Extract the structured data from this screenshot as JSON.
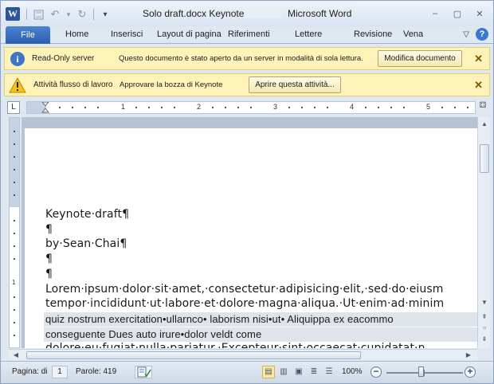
{
  "title": {
    "app_letter": "W",
    "document": "Solo draft.docx Keynote -",
    "app": "Microsoft Word"
  },
  "window_controls": {
    "minimize": "–",
    "restore": "▢",
    "close": "✕"
  },
  "ribbon": {
    "file": "File",
    "tabs": [
      "Home",
      "Inserisci",
      "Layout di pagina",
      "Riferimenti",
      "Lettere",
      "Revisione",
      "Vena"
    ],
    "help": "?"
  },
  "message_bars": [
    {
      "icon": "info-icon",
      "title": "Read-Only server",
      "text": "Questo documento è stato aperto da un server in modalità di sola lettura.",
      "button": "Modifica documento"
    },
    {
      "icon": "warning-icon",
      "title": "Attività flusso di lavoro",
      "text": "Approvare la bozza di Keynote",
      "button": "Aprire questa attività..."
    }
  ],
  "ruler": {
    "corner": "L",
    "numbers": [
      "1",
      "2",
      "3",
      "4",
      "5"
    ],
    "vertical_number": "1"
  },
  "document": {
    "lines": [
      "Keynote·draft¶",
      "¶",
      "by·Sean·Chai¶",
      "¶",
      "¶",
      "Lorem·ipsum·dolor·sit·amet,·consectetur·adipisicing·elit,·sed·do·eiusm",
      "tempor·incididunt·ut·labore·et·dolore·magna·aliqua.·Ut·enim·ad·minim"
    ],
    "highlighted_lines": [
      "quiz nostrum exercitation•ullarnco• laborism nisi•ut• Aliquippa ex eacommo",
      "conseguente Dues auto irure•dolor veldt come"
    ],
    "cut_line": "dolore·eu·fugiat·nulla·pariatur.·Excepteur·sint·occaecat·cupidatat·n"
  },
  "statusbar": {
    "page_label": "Pagina: di",
    "page_value": "1",
    "words": "Parole: 419",
    "zoom": "100%",
    "zoom_level_percent": 100
  }
}
